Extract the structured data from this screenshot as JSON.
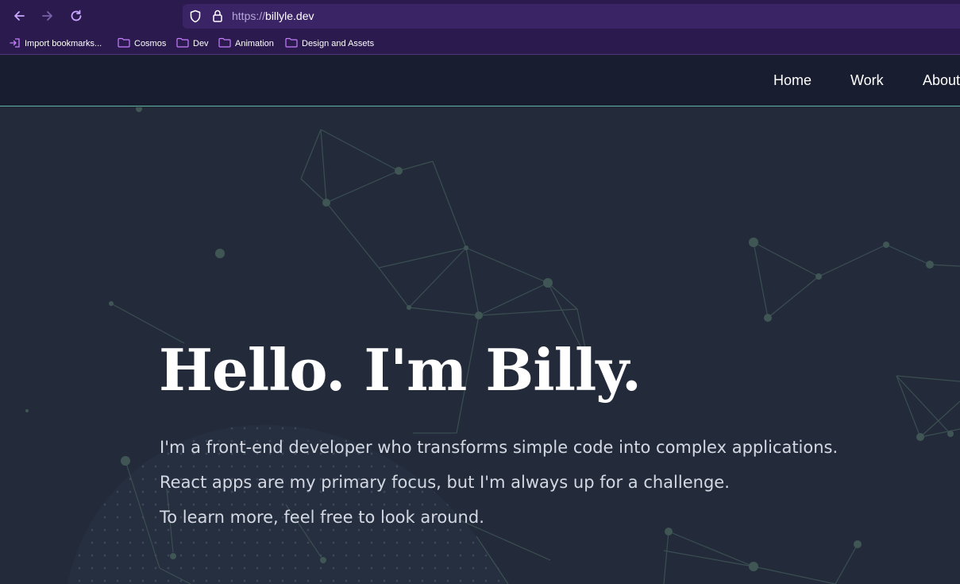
{
  "browser": {
    "url_scheme": "https://",
    "url_host": "billyle.dev",
    "icons": [
      "back-arrow-icon",
      "forward-arrow-icon",
      "reload-icon",
      "shield-icon",
      "lock-icon"
    ]
  },
  "bookmarks": [
    {
      "label": "Import bookmarks...",
      "icon": "import-icon"
    },
    {
      "label": "Cosmos",
      "icon": "folder-icon"
    },
    {
      "label": "Dev",
      "icon": "folder-icon"
    },
    {
      "label": "Animation",
      "icon": "folder-icon"
    },
    {
      "label": "Design and Assets",
      "icon": "folder-icon"
    }
  ],
  "nav": {
    "home": "Home",
    "work": "Work",
    "about": "About"
  },
  "hero": {
    "title": "Hello. I'm Billy.",
    "line1": "I'm a front-end developer who transforms simple code into complex applications.",
    "line2": "React apps are my primary focus, but I'm always up for a challenge.",
    "line3": "To learn more, feel free to look around."
  },
  "colors": {
    "browser_chrome": "#2a1a4d",
    "site_header": "#181d2f",
    "header_border": "#5fb3a1",
    "hero_bg": "#232b3b",
    "accent_icon": "#c77dff"
  }
}
